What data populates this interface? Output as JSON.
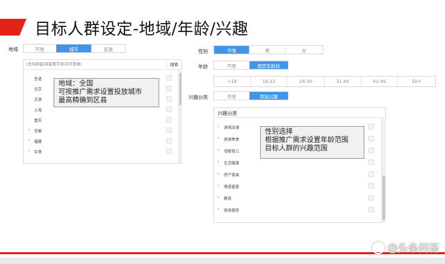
{
  "slide": {
    "title": "目标人群设定-地域/年龄/兴趣",
    "watermark": "@头条问答"
  },
  "region": {
    "label": "地域",
    "options": [
      "不限",
      "城市",
      "区县"
    ],
    "selected": "城市",
    "search_placeholder": "(支持拼音/拼音首字母/汉字查询)",
    "search_button": "搜索",
    "cities": [
      {
        "name": "全选",
        "expandable": false
      },
      {
        "name": "北京",
        "expandable": false
      },
      {
        "name": "天津",
        "expandable": false
      },
      {
        "name": "上海",
        "expandable": false
      },
      {
        "name": "重庆",
        "expandable": false
      },
      {
        "name": "安徽",
        "expandable": true
      },
      {
        "name": "福建",
        "expandable": true
      },
      {
        "name": "甘肃",
        "expandable": true
      }
    ]
  },
  "gender": {
    "label": "性别",
    "options": [
      "不限",
      "男",
      "女"
    ],
    "selected": "不限"
  },
  "age": {
    "label": "年龄",
    "options": [
      "不限",
      "固定年龄段"
    ],
    "selected": "固定年龄段",
    "ranges": [
      "<18",
      "18-23",
      "24-30",
      "31-40",
      "41-49",
      "50+"
    ]
  },
  "interest": {
    "label": "兴趣分类",
    "options": [
      "不限",
      "添加兴趣"
    ],
    "selected": "添加兴趣",
    "panel_title": "兴趣分类",
    "categories": [
      "游戏动漫",
      "旅游美食",
      "母婴育儿",
      "生活健康",
      "房产家装",
      "情感星座",
      "教育",
      "商务服务"
    ]
  },
  "notes": {
    "region_note": [
      "地域：全国",
      "可按推广需求设置投放城市",
      "最高精确到区县"
    ],
    "interest_note": [
      "性别选择",
      "根据推广需求设置年龄范围",
      "目标人群的兴趣范围"
    ]
  },
  "colors": {
    "accent_red": "#e2231a",
    "active_blue": "#3f96e8"
  }
}
